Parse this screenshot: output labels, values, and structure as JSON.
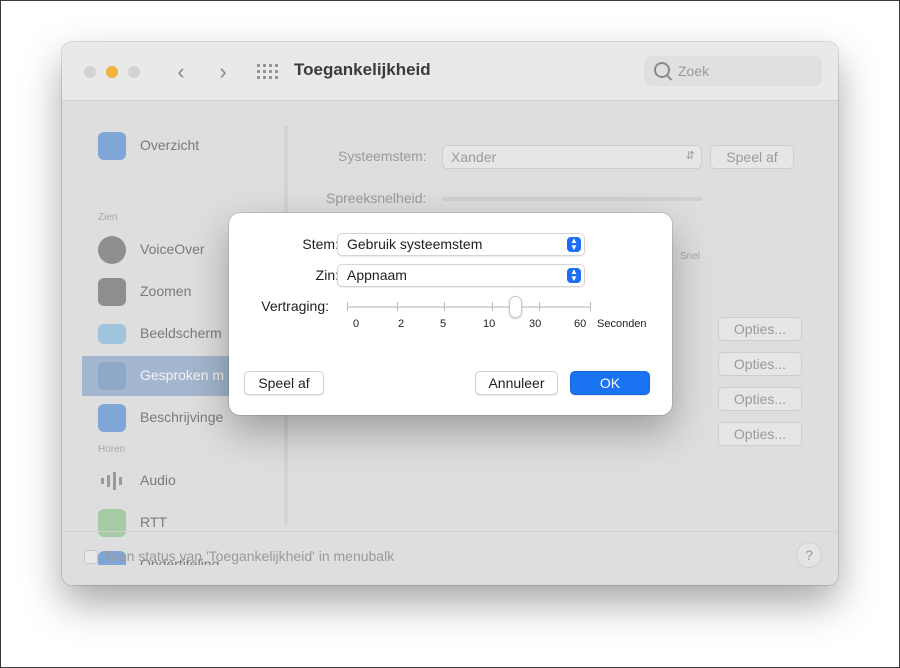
{
  "window": {
    "title": "Toegankelijkheid",
    "search_placeholder": "Zoek",
    "accent": "#1a73f0"
  },
  "sidebar": {
    "items": [
      {
        "label": "Overzicht",
        "icon": "info-icon",
        "color": "#7fa6d6"
      },
      {
        "section": "Zien"
      },
      {
        "label": "VoiceOver",
        "icon": "voiceover-icon",
        "color": "#8e8e8e"
      },
      {
        "label": "Zoomen",
        "icon": "zoom-icon",
        "color": "#8e8e8e"
      },
      {
        "label": "Beeldscherm",
        "icon": "display-icon",
        "color": "#9fc4dd"
      },
      {
        "label": "Gesproken m",
        "icon": "speech-bubble-icon",
        "color": "#8ea9c8",
        "selected": true
      },
      {
        "label": "Beschrijvinge",
        "icon": "description-icon",
        "color": "#7fa6d6"
      },
      {
        "section": "Horen"
      },
      {
        "label": "Audio",
        "icon": "speaker-icon",
        "color": "#9a9a9a"
      },
      {
        "label": "RTT",
        "icon": "rtt-icon",
        "color": "#a6c9a6"
      },
      {
        "label": "Ondertiteling",
        "icon": "captions-icon",
        "color": "#7fa6d6"
      }
    ]
  },
  "main": {
    "systeemstem_label": "Systeemstem:",
    "systeemstem_value": "Xander",
    "speel_af_label": "Speel af",
    "spreeksnelheid_label": "Spreeksnelheid:",
    "snel_label": "Snel",
    "opties_labels": [
      "Opties...",
      "Opties...",
      "Opties...",
      "Opties..."
    ]
  },
  "bottom": {
    "status_text": "Toon status van 'Toegankelijkheid' in menubalk",
    "help_label": "?"
  },
  "dialog": {
    "stem_label": "Stem:",
    "stem_value": "Gebruik systeemstem",
    "zin_label": "Zin:",
    "zin_value": "Appnaam",
    "vertraging_label": "Vertraging:",
    "ticks": [
      "0",
      "2",
      "5",
      "10",
      "30",
      "60"
    ],
    "unit_label": "Seconden",
    "delay_value_seconds": 20,
    "speel_af_button": "Speel af",
    "annuleer_button": "Annuleer",
    "ok_button": "OK"
  }
}
